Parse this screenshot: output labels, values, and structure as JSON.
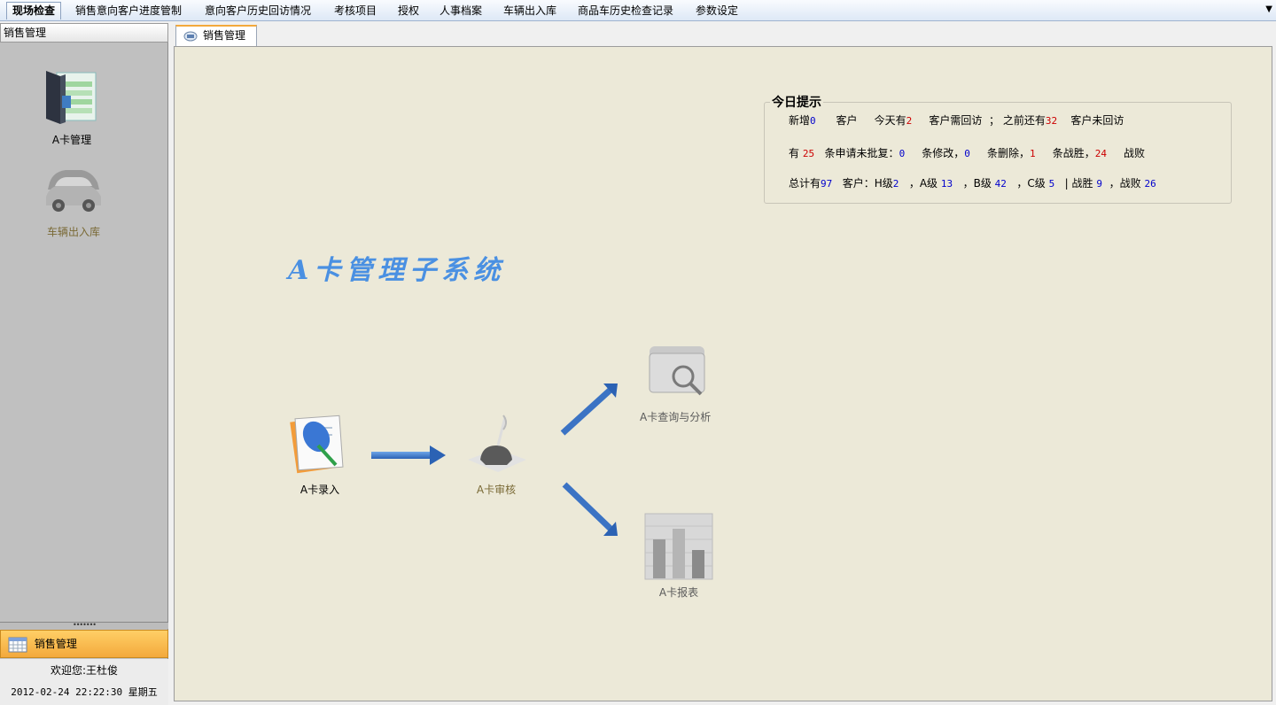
{
  "menu": {
    "items": [
      "现场检查",
      "销售意向客户进度管制",
      "意向客户历史回访情况",
      "考核项目",
      "授权",
      "人事档案",
      "车辆出入库",
      "商品车历史检查记录",
      "参数设定"
    ],
    "dropdown": "▼"
  },
  "left_panel": {
    "header": "销售管理",
    "launchers": [
      "A卡管理",
      "车辆出入库"
    ],
    "nav_section": "销售管理",
    "splitter": "•••••••",
    "welcome": "欢迎您:王杜俊",
    "datetime": "2012-02-24  22:22:30 星期五"
  },
  "tab": {
    "label": "销售管理"
  },
  "tips": {
    "title": "今日提示",
    "l1": {
      "a": "新增",
      "new": "0",
      "b": "客户",
      "c": "今天有",
      "today": "2",
      "d": "客户需回访",
      "e": "；",
      "f": "之前还有",
      "before": "32",
      "g": "客户未回访"
    },
    "l2": {
      "a": "有",
      "pending": "25",
      "b": "条申请未批复：",
      "modify": "0",
      "c": "条修改，",
      "delete": "0",
      "d": "条删除，",
      "win": "1",
      "e": "条战胜，",
      "lose": "24",
      "f": "战败"
    },
    "l3": {
      "a": "总计有",
      "total": "97",
      "b": "客户：",
      "c": "H级",
      "h": "2",
      "d": "，A级",
      "a_level": "13",
      "e": "，B级",
      "b_level": "42",
      "f": "，C级",
      "c_level": "5",
      "g": "| 战胜",
      "won": "9",
      "h2": "，战败",
      "lost": "26"
    }
  },
  "system_title": "A卡管理子系统",
  "flow": {
    "entry": "A卡录入",
    "review": "A卡审核",
    "query": "A卡查询与分析",
    "report": "A卡报表"
  },
  "colors": {
    "accent_orange": "#f3a93c",
    "title_blue": "#4a90e2",
    "number_blue": "#0000cc",
    "number_red": "#cc0000",
    "content_bg": "#ece9d8"
  }
}
